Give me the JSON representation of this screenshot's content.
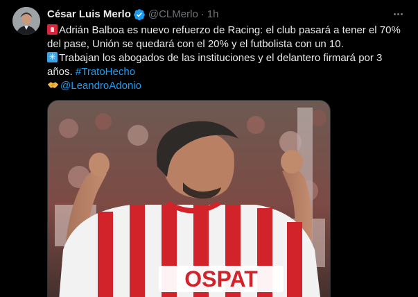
{
  "author": {
    "display_name": "César Luis Merlo",
    "handle": "@CLMerlo",
    "separator": "·",
    "time": "1h",
    "verified": true,
    "avatar_icon": "user-avatar"
  },
  "tweet": {
    "line1": "Adrián Balboa es nuevo refuerzo de Racing: el club pasará a tener el 70%",
    "line2": "del pase, Unión se quedará con el 20% y el futbolista con un 10.",
    "line3": "Trabajan los abogados de las instituciones y el delantero firmará por 3",
    "line4_text": "años. ",
    "hashtag": "#TratoHecho",
    "mention": "@LeandroAdonio",
    "emojis": [
      "siren-icon",
      "asterisk-icon",
      "handshake-icon"
    ]
  },
  "media": {
    "shirt_sponsor": "OSPAT"
  },
  "colors": {
    "background": "#000000",
    "text": "#e7e9ea",
    "muted": "#71767b",
    "link": "#1d9bf0",
    "verified": "#1d9bf0"
  }
}
